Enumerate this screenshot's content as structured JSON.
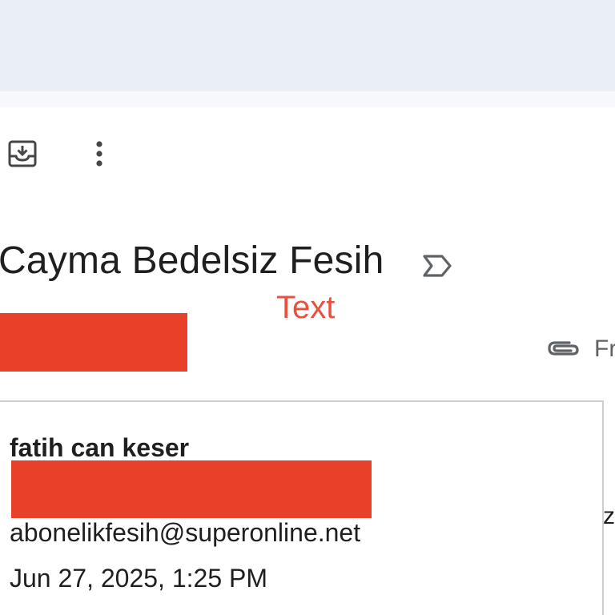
{
  "header": {
    "archive_icon": "archive-icon",
    "more_icon": "more-vert-icon"
  },
  "email": {
    "subject": "Cayma Bedelsiz Fesih",
    "label_icon": "label-important-icon",
    "attachment_icon": "attachment-icon",
    "attachment_partial_text": "Fr"
  },
  "annotation": {
    "text": "Text",
    "color": "#e8513e"
  },
  "sender_card": {
    "name": "fatih can keser",
    "email": "abonelikfesih@superonline.net",
    "date": "Jun 27, 2025, 1:25 PM"
  },
  "partial_right_text": "z",
  "colors": {
    "band": "#e9eef7",
    "redaction": "#e8412a",
    "text": "#1f1f1f"
  }
}
